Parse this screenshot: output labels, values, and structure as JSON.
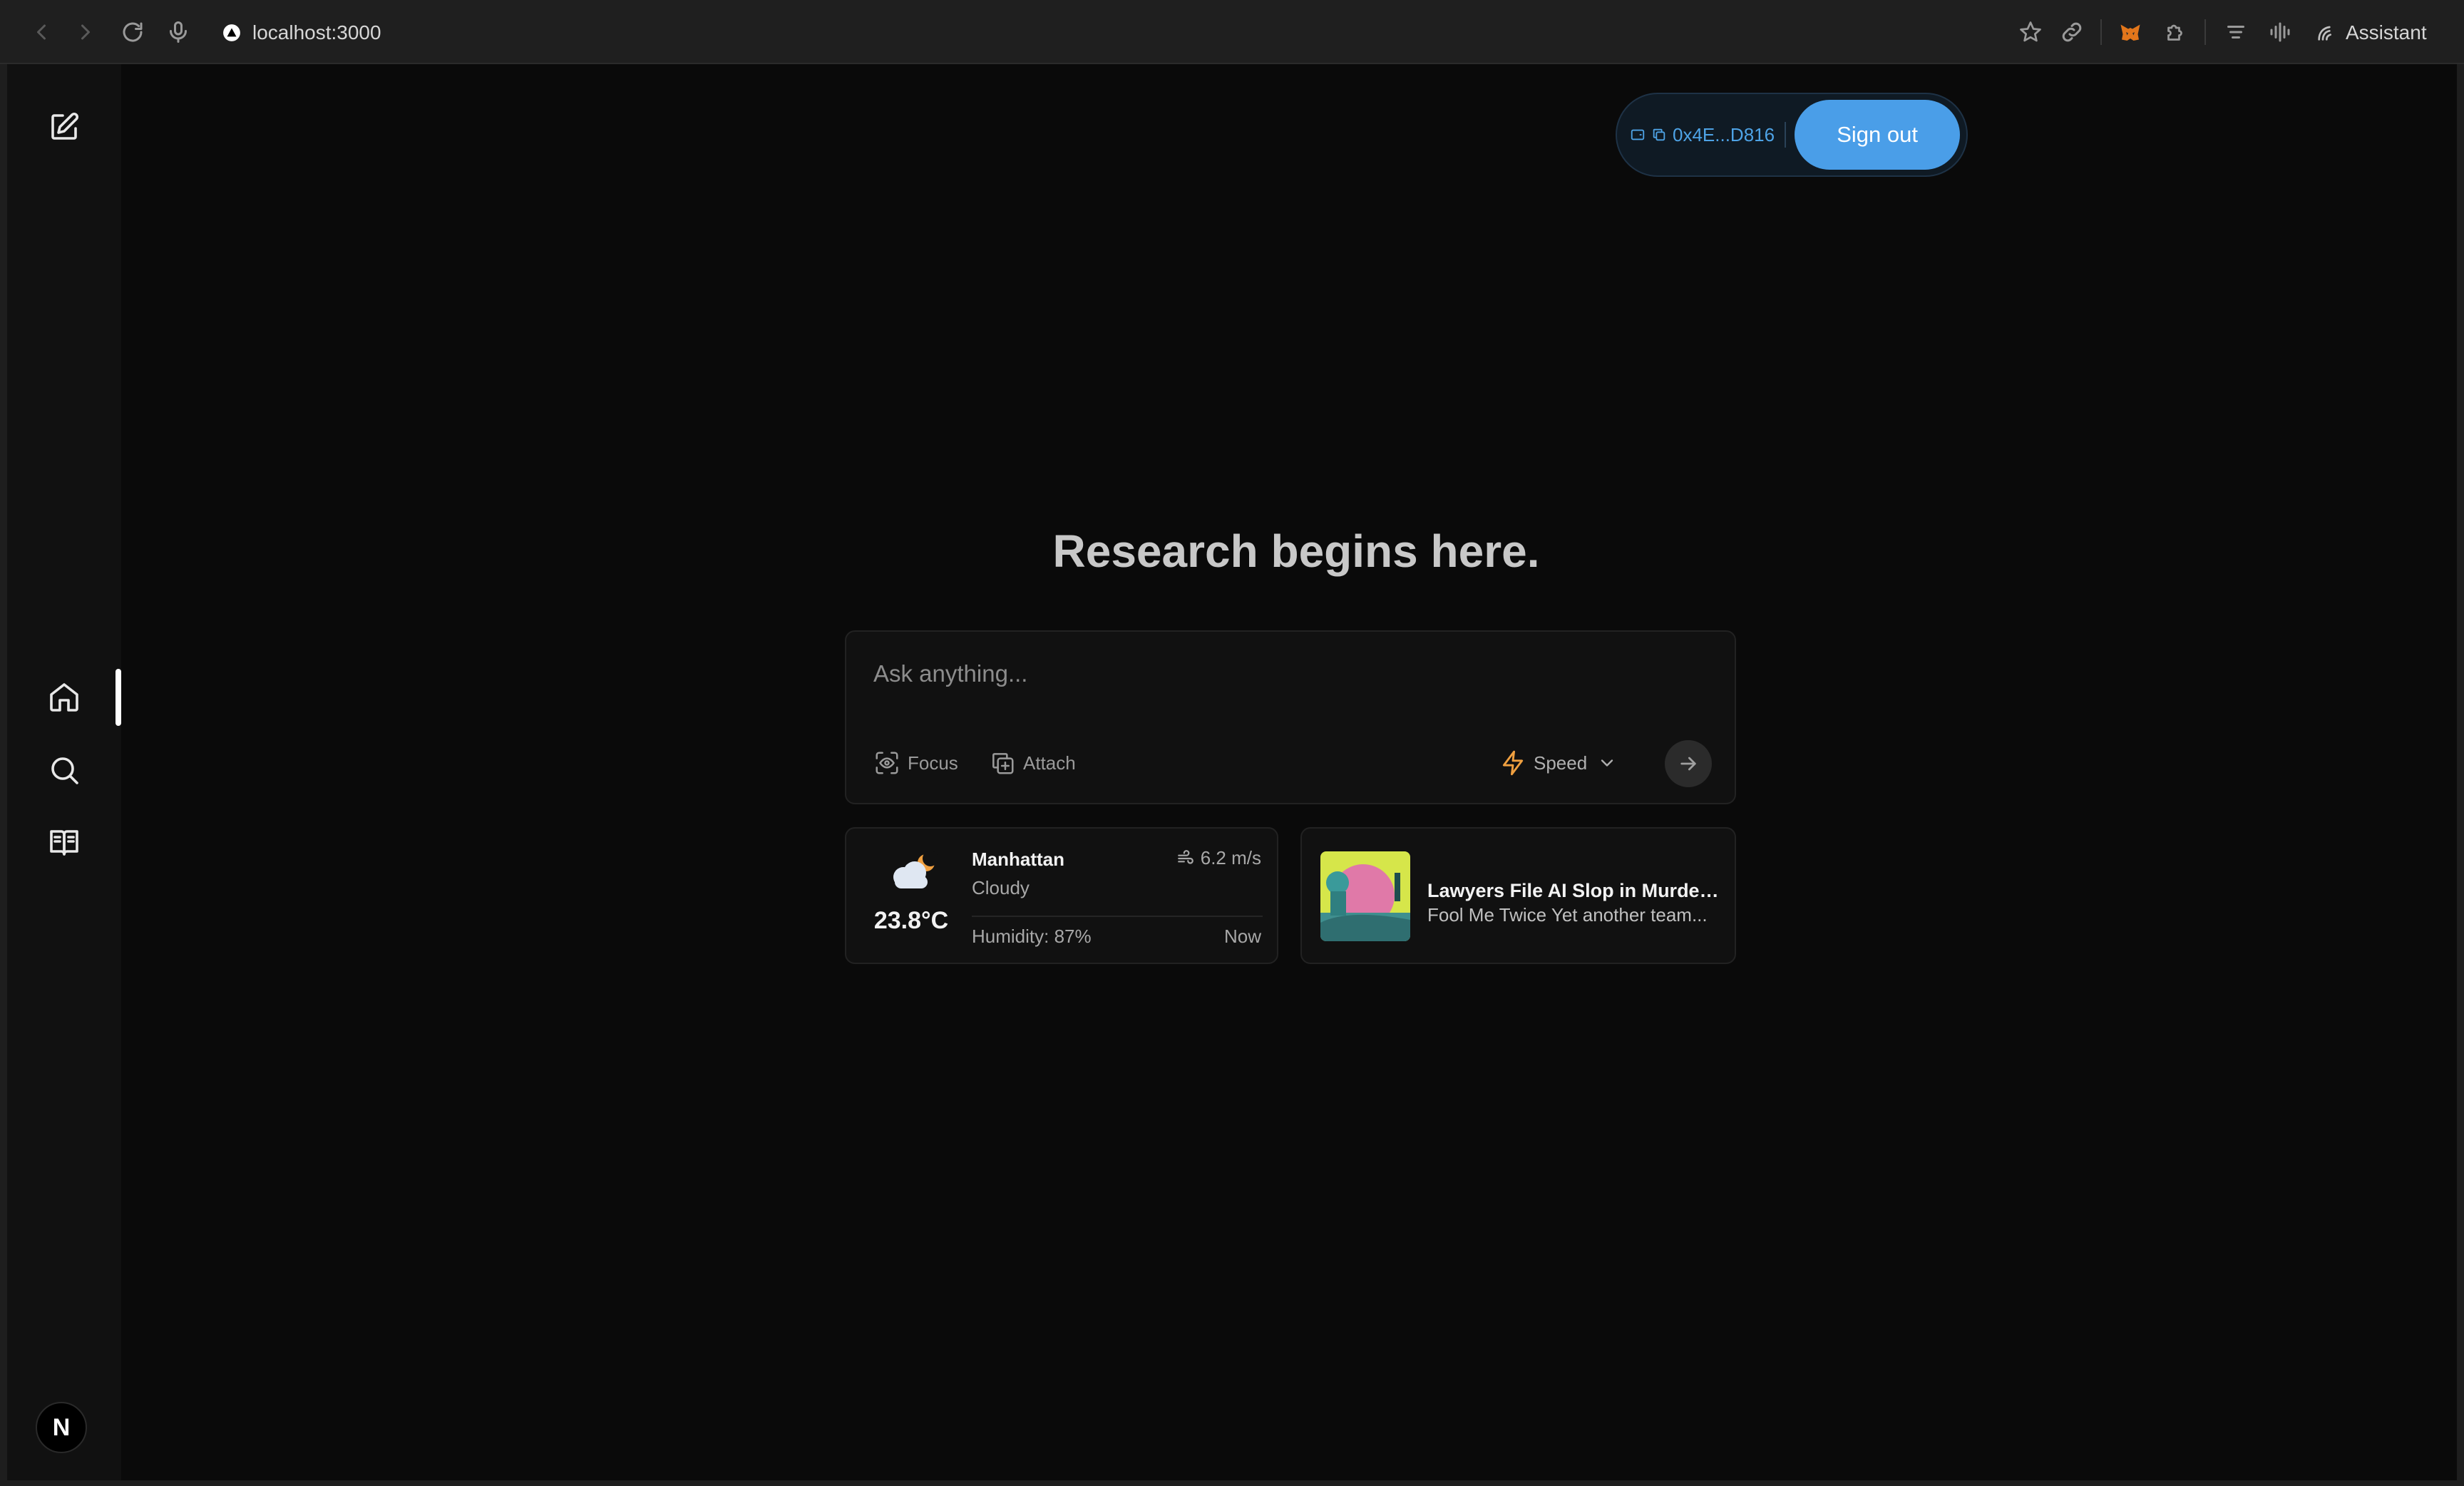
{
  "browser": {
    "url": "localhost:3000",
    "assistant_label": "Assistant"
  },
  "wallet": {
    "address": "0x4E...D816",
    "sign_out_label": "Sign out"
  },
  "sidebar": {
    "items": [
      {
        "name": "new-chat",
        "icon": "edit-icon"
      },
      {
        "name": "home",
        "icon": "home-icon",
        "active": true
      },
      {
        "name": "discover",
        "icon": "search-icon"
      },
      {
        "name": "library",
        "icon": "book-open-icon"
      }
    ],
    "avatar_letter": "N"
  },
  "main": {
    "title": "Research begins here.",
    "search": {
      "placeholder": "Ask anything...",
      "value": "",
      "focus_label": "Focus",
      "attach_label": "Attach",
      "mode_label": "Speed"
    }
  },
  "weather": {
    "city": "Manhattan",
    "condition": "Cloudy",
    "temperature": "23.8°C",
    "wind": "6.2 m/s",
    "humidity": "Humidity: 87%",
    "time": "Now"
  },
  "news": {
    "title": "Lawyers File AI Slop in Murder...",
    "snippet": "Fool Me Twice Yet another team..."
  },
  "colors": {
    "accent": "#4a9ee8",
    "speed_icon": "#f0a040",
    "background": "#0a0a0a"
  }
}
